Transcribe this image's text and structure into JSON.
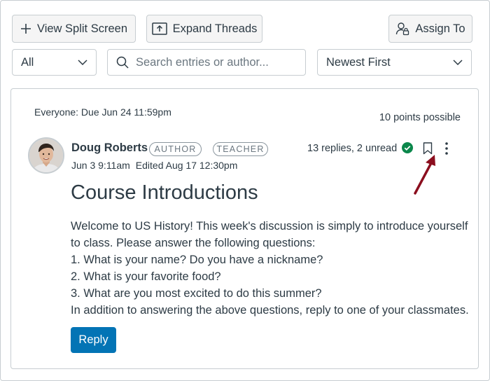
{
  "toolbar": {
    "split_screen_label": "View Split Screen",
    "expand_threads_label": "Expand Threads",
    "assign_to_label": "Assign To"
  },
  "filters": {
    "filter_value": "All",
    "search_placeholder": "Search entries or author...",
    "sort_value": "Newest First"
  },
  "post": {
    "due_text": "Everyone: Due Jun 24 11:59pm",
    "points_text": "10 points possible",
    "author_name": "Doug Roberts",
    "badges": [
      "AUTHOR",
      "TEACHER"
    ],
    "posted_date": "Jun 3 9:11am",
    "edited_date": "Edited Aug 17 12:30pm",
    "reply_count_text": "13 replies, 2 unread",
    "title": "Course Introductions",
    "body_lines": [
      "Welcome to US History! This week's discussion is simply to introduce yourself",
      "to class. Please answer the following questions:",
      "1. What is your name? Do you have a nickname?",
      "2. What is your favorite food?",
      "3. What are you most excited to do this summer?",
      "In addition to answering the above questions, reply to one of your classmates."
    ],
    "reply_label": "Reply"
  },
  "colors": {
    "primary": "#0374b5",
    "success": "#0b874b",
    "annotation_arrow": "#8b0e1e",
    "text": "#2d3b45",
    "border": "#c7cdd1"
  }
}
